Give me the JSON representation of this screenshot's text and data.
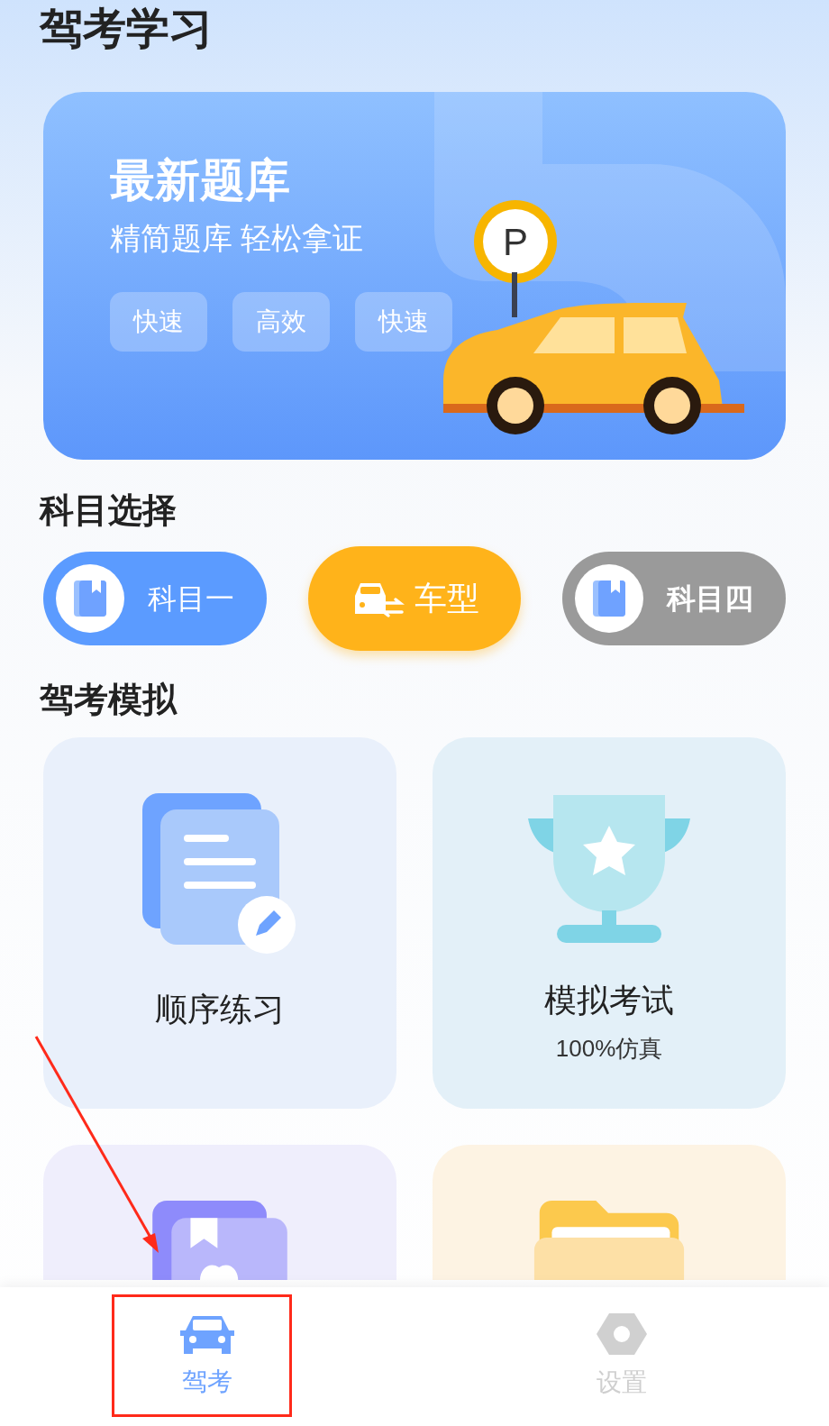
{
  "header": {
    "title": "驾考学习"
  },
  "banner": {
    "title": "最新题库",
    "subtitle": "精简题库 轻松拿证",
    "tags": [
      "快速",
      "高效",
      "快速"
    ],
    "sign": "P"
  },
  "subjects": {
    "title": "科目选择",
    "items": [
      {
        "label": "科目一",
        "kind": "book",
        "color": "#5b9bff",
        "selected": false
      },
      {
        "label": "车型",
        "kind": "car-switch",
        "color": "#ffb31a",
        "selected": true
      },
      {
        "label": "科目四",
        "kind": "book",
        "color": "#9a9a9a",
        "selected": false
      }
    ]
  },
  "simulation": {
    "title": "驾考模拟",
    "cards": [
      {
        "kind": "document",
        "title": "顺序练习",
        "color": "#e9f0fb"
      },
      {
        "kind": "trophy",
        "title": "模拟考试",
        "subtitle": "100%仿真",
        "color": "#e3f0f8"
      },
      {
        "kind": "bookmark",
        "color": "#efeefc"
      },
      {
        "kind": "folder",
        "color": "#fdf3e3"
      }
    ]
  },
  "tab_bar": [
    {
      "label": "驾考",
      "kind": "car",
      "selected": true
    },
    {
      "label": "设置",
      "kind": "settings",
      "selected": false
    }
  ]
}
